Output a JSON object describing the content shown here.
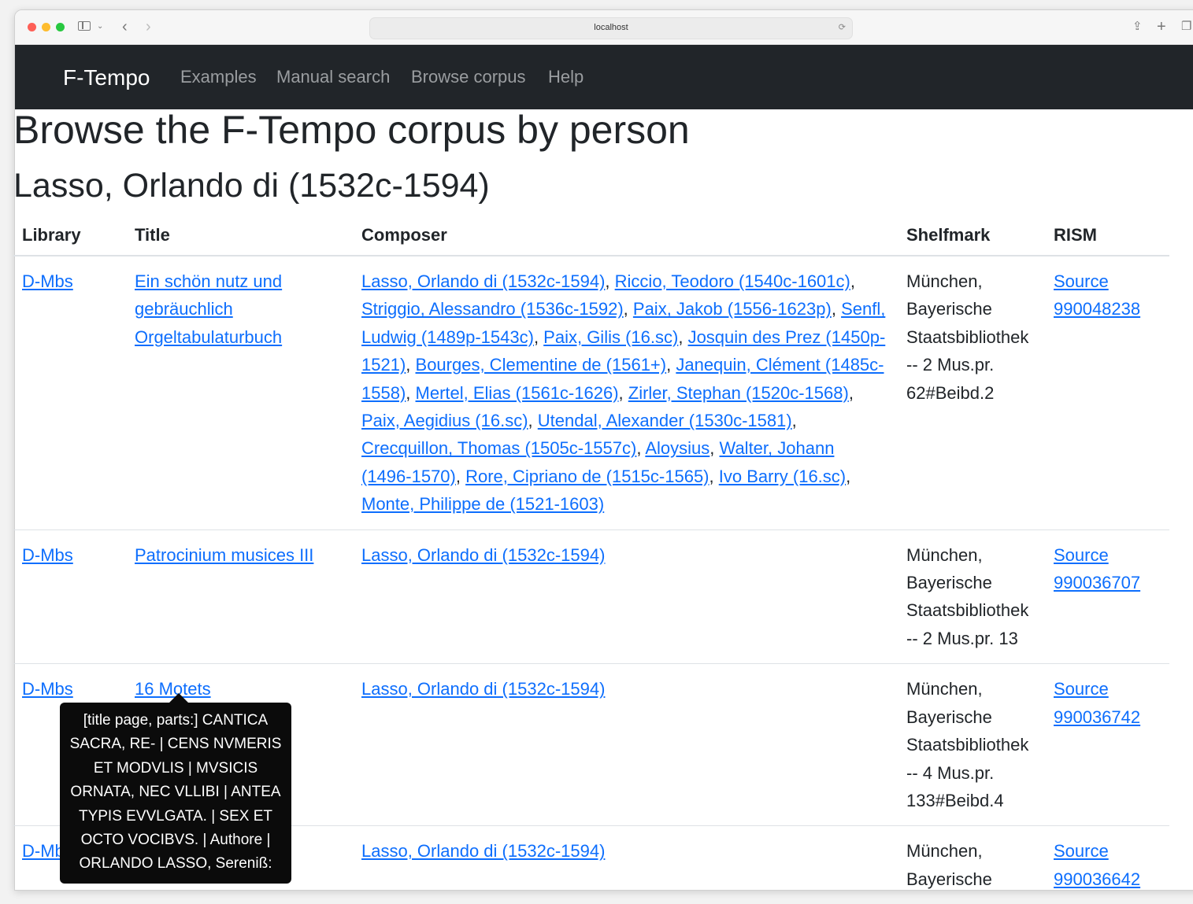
{
  "browser": {
    "url": "localhost"
  },
  "navbar": {
    "brand": "F-Tempo",
    "links": [
      "Examples",
      "Manual search",
      "Browse corpus",
      "Help"
    ]
  },
  "page": {
    "title": "Browse the F-Tempo corpus by person",
    "person": "Lasso, Orlando di (1532c-1594)"
  },
  "table": {
    "headers": [
      "Library",
      "Title",
      "Composer",
      "Shelfmark",
      "RISM"
    ],
    "rows": [
      {
        "library": "D-Mbs",
        "title": "Ein schön nutz und gebräuchlich Orgeltabulaturbuch",
        "composers": [
          "Lasso, Orlando di (1532c-1594)",
          "Riccio, Teodoro (1540c-1601c)",
          "Striggio, Alessandro (1536c-1592)",
          "Paix, Jakob (1556-1623p)",
          "Senfl, Ludwig (1489p-1543c)",
          "Paix, Gilis (16.sc)",
          "Josquin des Prez (1450p-1521)",
          "Bourges, Clementine de (1561+)",
          "Janequin, Clément (1485c-1558)",
          "Mertel, Elias (1561c-1626)",
          "Zirler, Stephan (1520c-1568)",
          "Paix, Aegidius (16.sc)",
          "Utendal, Alexander (1530c-1581)",
          "Crecquillon, Thomas (1505c-1557c)",
          "Aloysius",
          "Walter, Johann (1496-1570)",
          "Rore, Cipriano de (1515c-1565)",
          "Ivo Barry (16.sc)",
          "Monte, Philippe de (1521-1603)"
        ],
        "shelfmark": "München, Bayerische Staatsbibliothek -- 2 Mus.pr. 62#Beibd.2",
        "rism_label": "Source",
        "rism_id": "990048238"
      },
      {
        "library": "D-Mbs",
        "title": "Patrocinium musices III",
        "composers": [
          "Lasso, Orlando di (1532c-1594)"
        ],
        "shelfmark": "München, Bayerische Staatsbibliothek -- 2 Mus.pr. 13",
        "rism_label": "Source",
        "rism_id": "990036707"
      },
      {
        "library": "D-Mbs",
        "title": "16 Motets",
        "composers": [
          "Lasso, Orlando di (1532c-1594)"
        ],
        "shelfmark": "München, Bayerische Staatsbibliothek -- 4 Mus.pr. 133#Beibd.4",
        "rism_label": "Source",
        "rism_id": "990036742"
      },
      {
        "library": "D-Mbs",
        "title": "",
        "composers": [
          "Lasso, Orlando di (1532c-1594)"
        ],
        "shelfmark": "München, Bayerische",
        "rism_label": "Source",
        "rism_id": "990036642"
      }
    ]
  },
  "tooltip": {
    "text": "[title page, parts:] CANTICA SACRA, RE- | CENS NVMERIS ET MODVLIS | MVSICIS ORNATA, NEC VLLIBI | ANTEA TYPIS EVVLGATA. | SEX ET OCTO VOCIBVS. | Authore | ORLANDO LASSO, Sereniß:"
  }
}
